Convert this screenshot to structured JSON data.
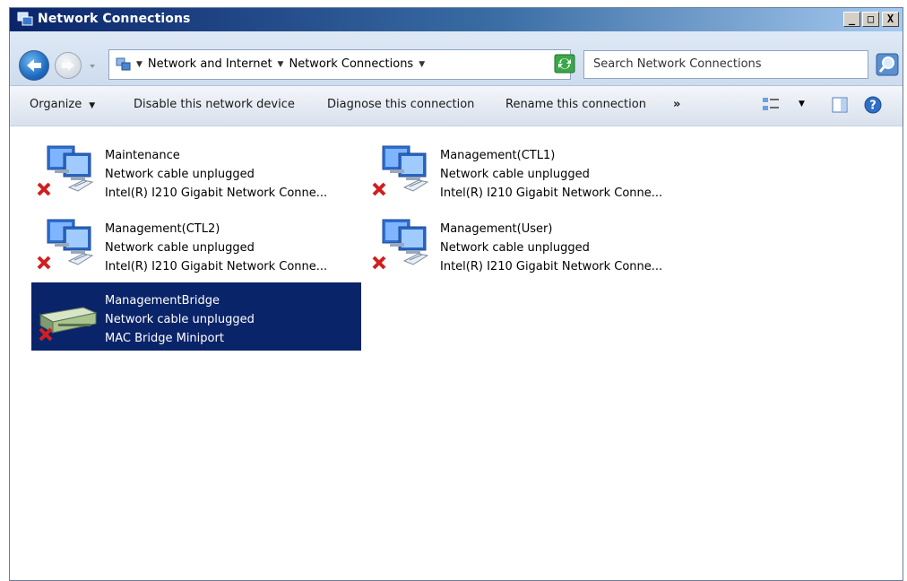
{
  "window": {
    "title": "Network Connections",
    "caption_buttons": {
      "minimize": "_",
      "maximize": "□",
      "close": "X"
    }
  },
  "address": {
    "breadcrumbs": [
      "Network and Internet",
      "Network Connections"
    ],
    "search_placeholder": "Search Network Connections"
  },
  "toolbar": {
    "organize": "Organize",
    "disable": "Disable this network device",
    "diagnose": "Diagnose this connection",
    "rename": "Rename this connection",
    "more": "»"
  },
  "connections": [
    {
      "name": "Maintenance",
      "status": "Network cable unplugged",
      "device": "Intel(R) I210 Gigabit Network Conne...",
      "icon": "network-adapter-icon",
      "disconnected": true,
      "selected": false
    },
    {
      "name": "Management(CTL1)",
      "status": "Network cable unplugged",
      "device": "Intel(R) I210 Gigabit Network Conne...",
      "icon": "network-adapter-icon",
      "disconnected": true,
      "selected": false
    },
    {
      "name": "Management(CTL2)",
      "status": "Network cable unplugged",
      "device": "Intel(R) I210 Gigabit Network Conne...",
      "icon": "network-adapter-icon",
      "disconnected": true,
      "selected": false
    },
    {
      "name": "Management(User)",
      "status": "Network cable unplugged",
      "device": "Intel(R) I210 Gigabit Network Conne...",
      "icon": "network-adapter-icon",
      "disconnected": true,
      "selected": false
    },
    {
      "name": "ManagementBridge",
      "status": "Network cable unplugged",
      "device": "MAC Bridge Miniport",
      "icon": "network-bridge-icon",
      "disconnected": true,
      "selected": true
    }
  ],
  "colors": {
    "selection": "#0a246a",
    "title_gradient_start": "#0a246a",
    "title_gradient_end": "#a6caf0"
  }
}
